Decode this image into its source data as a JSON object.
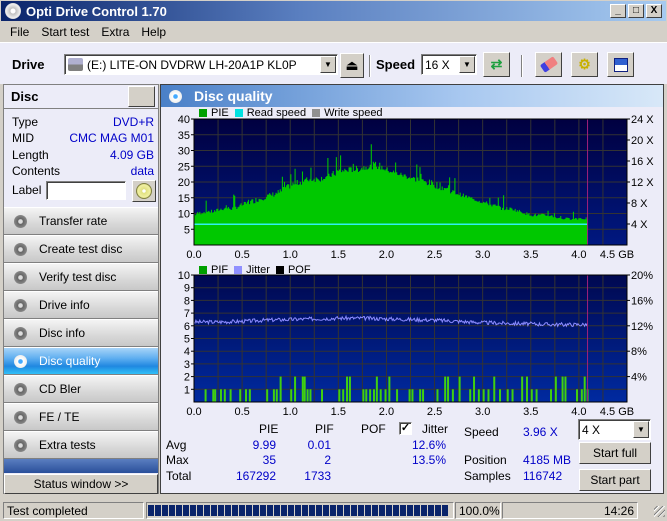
{
  "window": {
    "title": "Opti Drive Control 1.70",
    "minimize": "_",
    "maximize": "□",
    "close": "X"
  },
  "menu": [
    "File",
    "Start test",
    "Extra",
    "Help"
  ],
  "toolbar": {
    "drive_label": "Drive",
    "drive_value": "(E:)  LITE-ON DVDRW LH-20A1P KL0P",
    "speed_label": "Speed",
    "speed_value": "16 X"
  },
  "disc": {
    "header": "Disc",
    "rows": [
      {
        "label": "Type",
        "value": "DVD+R"
      },
      {
        "label": "MID",
        "value": "CMC MAG M01"
      },
      {
        "label": "Length",
        "value": "4.09 GB"
      },
      {
        "label": "Contents",
        "value": "data"
      }
    ],
    "label_field": "Label",
    "label_value": ""
  },
  "nav": [
    {
      "label": "Transfer rate",
      "active": false
    },
    {
      "label": "Create test disc",
      "active": false
    },
    {
      "label": "Verify test disc",
      "active": false
    },
    {
      "label": "Drive info",
      "active": false
    },
    {
      "label": "Disc info",
      "active": false
    },
    {
      "label": "Disc quality",
      "active": true
    },
    {
      "label": "CD Bler",
      "active": false
    },
    {
      "label": "FE / TE",
      "active": false
    },
    {
      "label": "Extra tests",
      "active": false
    }
  ],
  "status_window_button": "Status window >>",
  "panel": {
    "title": "Disc quality"
  },
  "chart_data": [
    {
      "type": "bar",
      "title": "PIE / Read speed",
      "legend": [
        {
          "name": "PIE",
          "color": "#00a000"
        },
        {
          "name": "Read speed",
          "color": "#00e0e0"
        },
        {
          "name": "Write speed",
          "color": "#909090"
        }
      ],
      "xlabel": "GB",
      "xlim": [
        0,
        4.5
      ],
      "x_ticks": [
        "0.0",
        "0.5",
        "1.0",
        "1.5",
        "2.0",
        "2.5",
        "3.0",
        "3.5",
        "4.0",
        "4.5 GB"
      ],
      "ylim": [
        0,
        40
      ],
      "y_ticks": [
        "5",
        "10",
        "15",
        "20",
        "25",
        "30",
        "35",
        "40"
      ],
      "y2lim": [
        0,
        24
      ],
      "y2_ticks": [
        "4 X",
        "8 X",
        "12 X",
        "16 X",
        "20 X",
        "24 X"
      ],
      "grid": true,
      "end_marker_gb": 4.09,
      "pie_envelope": {
        "x": [
          0.0,
          0.1,
          0.2,
          0.3,
          0.4,
          0.5,
          0.6,
          0.7,
          0.8,
          0.9,
          1.0,
          1.1,
          1.2,
          1.3,
          1.4,
          1.5,
          1.6,
          1.7,
          1.8,
          1.9,
          2.0,
          2.1,
          2.2,
          2.3,
          2.4,
          2.5,
          2.6,
          2.7,
          2.8,
          2.9,
          3.0,
          3.1,
          3.2,
          3.3,
          3.4,
          3.5,
          3.6,
          3.7,
          3.8,
          3.9,
          4.0,
          4.09
        ],
        "base": [
          9,
          10,
          10,
          11,
          11,
          12,
          13,
          14,
          15,
          16,
          18,
          19,
          20,
          20,
          21,
          22,
          23,
          23,
          24,
          24,
          23,
          22,
          21,
          20,
          19,
          18,
          17,
          16,
          15,
          14,
          13,
          12,
          11,
          11,
          10,
          9,
          9,
          9,
          8,
          8,
          8,
          8
        ],
        "peak": [
          15,
          14,
          15,
          16,
          16,
          18,
          20,
          22,
          22,
          24,
          26,
          27,
          28,
          28,
          28,
          33,
          30,
          32,
          32,
          35,
          30,
          28,
          28,
          27,
          27,
          28,
          26,
          22,
          20,
          19,
          18,
          17,
          16,
          15,
          14,
          13,
          13,
          12,
          11,
          11,
          12,
          11
        ]
      },
      "read_speed_x": 3.96,
      "summary": {
        "pie_avg": 9.99,
        "pie_max": 35,
        "pie_total": 167292
      }
    },
    {
      "type": "bar",
      "title": "PIF / Jitter",
      "legend": [
        {
          "name": "PIF",
          "color": "#00a000"
        },
        {
          "name": "Jitter",
          "color": "#9090ff"
        },
        {
          "name": "POF",
          "color": "#000000"
        }
      ],
      "xlabel": "GB",
      "xlim": [
        0,
        4.5
      ],
      "x_ticks": [
        "0.0",
        "0.5",
        "1.0",
        "1.5",
        "2.0",
        "2.5",
        "3.0",
        "3.5",
        "4.0",
        "4.5 GB"
      ],
      "ylim": [
        0,
        10
      ],
      "y_ticks": [
        "1",
        "2",
        "3",
        "4",
        "5",
        "6",
        "7",
        "8",
        "9",
        "10"
      ],
      "y2lim": [
        0,
        20
      ],
      "y2_ticks": [
        "4%",
        "8%",
        "12%",
        "16%",
        "20%"
      ],
      "grid": true,
      "end_marker_gb": 4.09,
      "pif_bars": [
        {
          "x": 0.11,
          "v": 1
        },
        {
          "x": 0.19,
          "v": 1
        },
        {
          "x": 0.21,
          "v": 1
        },
        {
          "x": 0.27,
          "v": 1
        },
        {
          "x": 0.31,
          "v": 1
        },
        {
          "x": 0.37,
          "v": 1
        },
        {
          "x": 0.47,
          "v": 1
        },
        {
          "x": 0.53,
          "v": 1
        },
        {
          "x": 0.57,
          "v": 1
        },
        {
          "x": 0.75,
          "v": 1
        },
        {
          "x": 0.82,
          "v": 1
        },
        {
          "x": 0.85,
          "v": 1
        },
        {
          "x": 0.89,
          "v": 2
        },
        {
          "x": 1.0,
          "v": 1
        },
        {
          "x": 1.04,
          "v": 2
        },
        {
          "x": 1.12,
          "v": 2
        },
        {
          "x": 1.14,
          "v": 2
        },
        {
          "x": 1.17,
          "v": 1
        },
        {
          "x": 1.2,
          "v": 1
        },
        {
          "x": 1.32,
          "v": 1
        },
        {
          "x": 1.5,
          "v": 1
        },
        {
          "x": 1.54,
          "v": 1
        },
        {
          "x": 1.58,
          "v": 2
        },
        {
          "x": 1.61,
          "v": 2
        },
        {
          "x": 1.75,
          "v": 1
        },
        {
          "x": 1.78,
          "v": 1
        },
        {
          "x": 1.82,
          "v": 1
        },
        {
          "x": 1.86,
          "v": 1
        },
        {
          "x": 1.89,
          "v": 2
        },
        {
          "x": 1.93,
          "v": 1
        },
        {
          "x": 1.98,
          "v": 1
        },
        {
          "x": 2.02,
          "v": 2
        },
        {
          "x": 2.1,
          "v": 1
        },
        {
          "x": 2.23,
          "v": 1
        },
        {
          "x": 2.26,
          "v": 1
        },
        {
          "x": 2.34,
          "v": 1
        },
        {
          "x": 2.37,
          "v": 1
        },
        {
          "x": 2.52,
          "v": 1
        },
        {
          "x": 2.6,
          "v": 2
        },
        {
          "x": 2.63,
          "v": 2
        },
        {
          "x": 2.68,
          "v": 1
        },
        {
          "x": 2.75,
          "v": 2
        },
        {
          "x": 2.86,
          "v": 1
        },
        {
          "x": 2.9,
          "v": 2
        },
        {
          "x": 2.95,
          "v": 1
        },
        {
          "x": 3.0,
          "v": 1
        },
        {
          "x": 3.05,
          "v": 1
        },
        {
          "x": 3.11,
          "v": 2
        },
        {
          "x": 3.17,
          "v": 1
        },
        {
          "x": 3.25,
          "v": 1
        },
        {
          "x": 3.3,
          "v": 1
        },
        {
          "x": 3.4,
          "v": 2
        },
        {
          "x": 3.45,
          "v": 2
        },
        {
          "x": 3.5,
          "v": 1
        },
        {
          "x": 3.55,
          "v": 1
        },
        {
          "x": 3.7,
          "v": 1
        },
        {
          "x": 3.75,
          "v": 2
        },
        {
          "x": 3.82,
          "v": 2
        },
        {
          "x": 3.85,
          "v": 2
        },
        {
          "x": 3.97,
          "v": 1
        },
        {
          "x": 4.02,
          "v": 1
        },
        {
          "x": 4.05,
          "v": 2
        },
        {
          "x": 4.08,
          "v": 1
        }
      ],
      "jitter_pct": {
        "x": [
          0.0,
          0.25,
          0.5,
          0.75,
          1.0,
          1.25,
          1.5,
          1.75,
          2.0,
          2.25,
          2.5,
          2.75,
          3.0,
          3.25,
          3.5,
          3.75,
          4.0,
          4.09
        ],
        "y": [
          12.6,
          12.6,
          12.7,
          12.9,
          13.0,
          13.1,
          13.2,
          13.2,
          13.1,
          13.0,
          12.9,
          12.7,
          12.5,
          12.4,
          12.3,
          12.2,
          12.2,
          12.2
        ]
      },
      "summary": {
        "pif_avg": 0.01,
        "pif_max": 2,
        "pif_total": 1733,
        "jitter_avg": "12.6%",
        "jitter_max": "13.5%"
      }
    }
  ],
  "stats": {
    "col_headers": [
      "PIE",
      "PIF",
      "POF"
    ],
    "jitter_label": "Jitter",
    "jitter_checked": true,
    "rows": [
      {
        "label": "Avg",
        "pie": "9.99",
        "pif": "0.01",
        "jitter": "12.6%"
      },
      {
        "label": "Max",
        "pie": "35",
        "pif": "2",
        "jitter": "13.5%"
      },
      {
        "label": "Total",
        "pie": "167292",
        "pif": "1733",
        "jitter": ""
      }
    ],
    "speed_label": "Speed",
    "speed_value": "3.96 X",
    "speed_select": "4 X",
    "position_label": "Position",
    "position_value": "4185 MB",
    "samples_label": "Samples",
    "samples_value": "116742",
    "start_full": "Start full",
    "start_part": "Start part"
  },
  "statusbar": {
    "message": "Test completed",
    "progress_pct": 100,
    "progress_text": "100.0%",
    "time": "14:26"
  }
}
